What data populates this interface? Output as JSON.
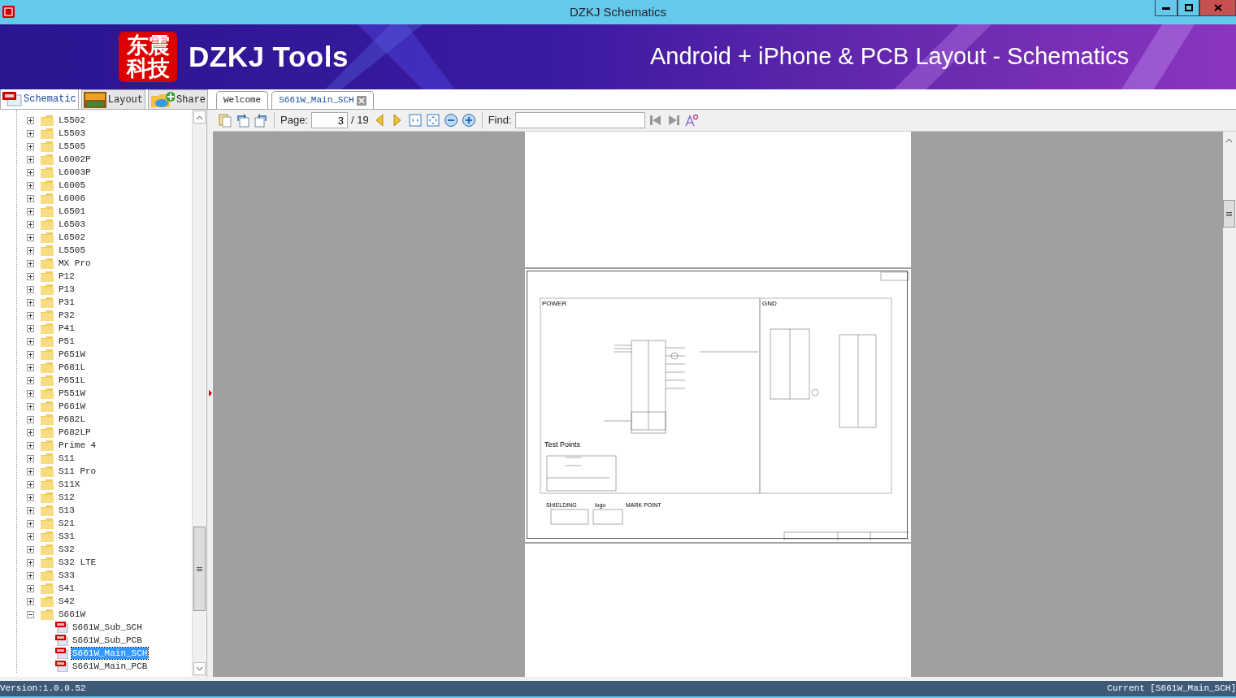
{
  "window": {
    "title": "DZKJ Schematics"
  },
  "banner": {
    "logo_text": [
      "东震",
      "科技"
    ],
    "title": "DZKJ Tools",
    "tagline": "Android + iPhone & PCB Layout - Schematics"
  },
  "side_tabs": [
    {
      "label": "Schematic",
      "kind": "pdf",
      "selected": true
    },
    {
      "label": "Layout",
      "kind": "pads",
      "selected": false
    },
    {
      "label": "Share",
      "kind": "cloud",
      "selected": false
    }
  ],
  "doc_tabs": [
    {
      "label": "Welcome",
      "selected": false,
      "closable": false
    },
    {
      "label": "S661W_Main_SCH",
      "selected": true,
      "closable": true
    }
  ],
  "tree": [
    {
      "label": "L5502",
      "kind": "folder",
      "expanded": false,
      "selected": false
    },
    {
      "label": "L5503",
      "kind": "folder",
      "expanded": false,
      "selected": false
    },
    {
      "label": "L5505",
      "kind": "folder",
      "expanded": false,
      "selected": false
    },
    {
      "label": "L6002P",
      "kind": "folder",
      "expanded": false,
      "selected": false
    },
    {
      "label": "L6003P",
      "kind": "folder",
      "expanded": false,
      "selected": false
    },
    {
      "label": "L6005",
      "kind": "folder",
      "expanded": false,
      "selected": false
    },
    {
      "label": "L6006",
      "kind": "folder",
      "expanded": false,
      "selected": false
    },
    {
      "label": "L6501",
      "kind": "folder",
      "expanded": false,
      "selected": false
    },
    {
      "label": "L6503",
      "kind": "folder",
      "expanded": false,
      "selected": false
    },
    {
      "label": "L6502",
      "kind": "folder",
      "expanded": false,
      "selected": false
    },
    {
      "label": "L5505",
      "kind": "folder",
      "expanded": false,
      "selected": false
    },
    {
      "label": "MX Pro",
      "kind": "folder",
      "expanded": false,
      "selected": false
    },
    {
      "label": "P12",
      "kind": "folder",
      "expanded": false,
      "selected": false
    },
    {
      "label": "P13",
      "kind": "folder",
      "expanded": false,
      "selected": false
    },
    {
      "label": "P31",
      "kind": "folder",
      "expanded": false,
      "selected": false
    },
    {
      "label": "P32",
      "kind": "folder",
      "expanded": false,
      "selected": false
    },
    {
      "label": "P41",
      "kind": "folder",
      "expanded": false,
      "selected": false
    },
    {
      "label": "P51",
      "kind": "folder",
      "expanded": false,
      "selected": false
    },
    {
      "label": "P651W",
      "kind": "folder",
      "expanded": false,
      "selected": false
    },
    {
      "label": "P681L",
      "kind": "folder",
      "expanded": false,
      "selected": false
    },
    {
      "label": "P651L",
      "kind": "folder",
      "expanded": false,
      "selected": false
    },
    {
      "label": "P551W",
      "kind": "folder",
      "expanded": false,
      "selected": false
    },
    {
      "label": "P661W",
      "kind": "folder",
      "expanded": false,
      "selected": false
    },
    {
      "label": "P682L",
      "kind": "folder",
      "expanded": false,
      "selected": false
    },
    {
      "label": "P682LP",
      "kind": "folder",
      "expanded": false,
      "selected": false
    },
    {
      "label": "Prime 4",
      "kind": "folder",
      "expanded": false,
      "selected": false
    },
    {
      "label": "S11",
      "kind": "folder",
      "expanded": false,
      "selected": false
    },
    {
      "label": "S11 Pro",
      "kind": "folder",
      "expanded": false,
      "selected": false
    },
    {
      "label": "S11X",
      "kind": "folder",
      "expanded": false,
      "selected": false
    },
    {
      "label": "S12",
      "kind": "folder",
      "expanded": false,
      "selected": false
    },
    {
      "label": "S13",
      "kind": "folder",
      "expanded": false,
      "selected": false
    },
    {
      "label": "S21",
      "kind": "folder",
      "expanded": false,
      "selected": false
    },
    {
      "label": "S31",
      "kind": "folder",
      "expanded": false,
      "selected": false
    },
    {
      "label": "S32",
      "kind": "folder",
      "expanded": false,
      "selected": false
    },
    {
      "label": "S32 LTE",
      "kind": "folder",
      "expanded": false,
      "selected": false
    },
    {
      "label": "S33",
      "kind": "folder",
      "expanded": false,
      "selected": false
    },
    {
      "label": "S41",
      "kind": "folder",
      "expanded": false,
      "selected": false
    },
    {
      "label": "S42",
      "kind": "folder",
      "expanded": false,
      "selected": false
    },
    {
      "label": "S661W",
      "kind": "folder",
      "expanded": true,
      "selected": false,
      "children": [
        {
          "label": "S661W_Sub_SCH",
          "kind": "pdf",
          "selected": false
        },
        {
          "label": "S661W_Sub_PCB",
          "kind": "pdf",
          "selected": false
        },
        {
          "label": "S661W_Main_SCH",
          "kind": "pdf",
          "selected": true
        },
        {
          "label": "S661W_Main_PCB",
          "kind": "pdf",
          "selected": false
        }
      ]
    }
  ],
  "toolbar": {
    "page_label": "Page:",
    "page_value": "3",
    "page_total": "/ 19",
    "find_label": "Find:"
  },
  "sheet": {
    "sections": [
      "POWER",
      "GND"
    ],
    "test_points": "Test Points",
    "footer_labels": [
      "SHIELDING",
      "logo",
      "MARK POINT"
    ]
  },
  "status_bar": {
    "version": "Version:1.0.0.52",
    "current": "Current [S661W_Main_SCH]"
  }
}
